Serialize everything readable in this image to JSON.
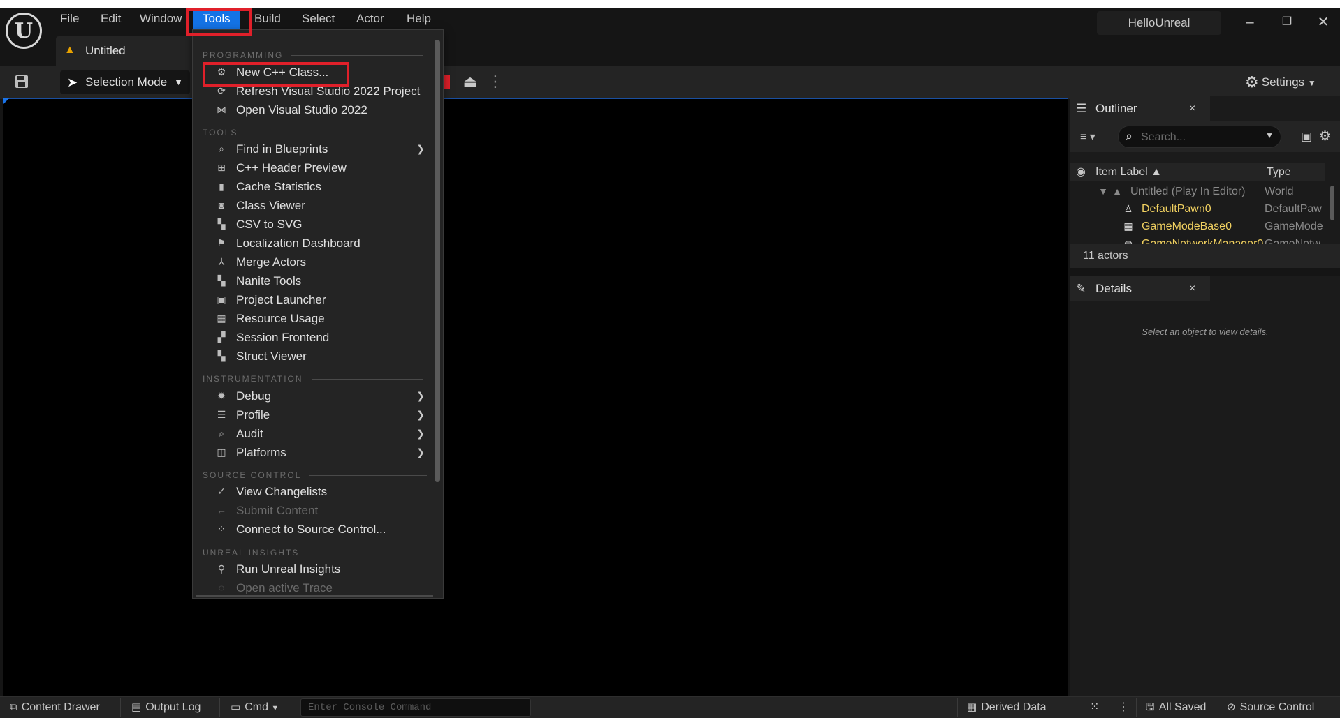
{
  "menubar": {
    "logo": "U",
    "items": [
      "File",
      "Edit",
      "Window",
      "Tools",
      "Build",
      "Select",
      "Actor",
      "Help"
    ],
    "active": "Tools",
    "project_name": "HelloUnreal",
    "minimize": "–",
    "restore": "❐",
    "close": "✕"
  },
  "tab": {
    "label": "Untitled",
    "icon": "level-icon"
  },
  "toolbar": {
    "selection_mode": "Selection Mode",
    "settings": "Settings"
  },
  "tools_menu": {
    "sections": [
      {
        "header": "PROGRAMMING",
        "items": [
          {
            "label": "New C++ Class...",
            "icon": "cpp-class-icon"
          },
          {
            "label": "Refresh Visual Studio 2022 Project",
            "icon": "refresh-icon"
          },
          {
            "label": "Open Visual Studio 2022",
            "icon": "visual-studio-icon"
          }
        ]
      },
      {
        "header": "TOOLS",
        "items": [
          {
            "label": "Find in Blueprints",
            "icon": "find-icon",
            "submenu": true
          },
          {
            "label": "C++ Header Preview",
            "icon": "header-icon"
          },
          {
            "label": "Cache Statistics",
            "icon": "chart-icon"
          },
          {
            "label": "Class Viewer",
            "icon": "class-viewer-icon"
          },
          {
            "label": "CSV to SVG",
            "icon": "csv-icon"
          },
          {
            "label": "Localization Dashboard",
            "icon": "flag-icon"
          },
          {
            "label": "Merge Actors",
            "icon": "merge-icon"
          },
          {
            "label": "Nanite Tools",
            "icon": "nanite-icon"
          },
          {
            "label": "Project Launcher",
            "icon": "launcher-icon"
          },
          {
            "label": "Resource Usage",
            "icon": "table-icon"
          },
          {
            "label": "Session Frontend",
            "icon": "session-icon"
          },
          {
            "label": "Struct Viewer",
            "icon": "struct-icon"
          }
        ]
      },
      {
        "header": "INSTRUMENTATION",
        "items": [
          {
            "label": "Debug",
            "icon": "bug-icon",
            "submenu": true
          },
          {
            "label": "Profile",
            "icon": "profile-icon",
            "submenu": true
          },
          {
            "label": "Audit",
            "icon": "audit-icon",
            "submenu": true
          },
          {
            "label": "Platforms",
            "icon": "platforms-icon",
            "submenu": true
          }
        ]
      },
      {
        "header": "SOURCE CONTROL",
        "items": [
          {
            "label": "View Changelists",
            "icon": "changelist-icon"
          },
          {
            "label": "Submit Content",
            "icon": "submit-icon",
            "disabled": true
          },
          {
            "label": "Connect to Source Control...",
            "icon": "connect-icon"
          }
        ]
      },
      {
        "header": "UNREAL INSIGHTS",
        "items": [
          {
            "label": "Run Unreal Insights",
            "icon": "insights-icon"
          },
          {
            "label": "Open active Trace",
            "icon": "trace-icon",
            "disabled": true
          }
        ]
      }
    ]
  },
  "outliner": {
    "title": "Outliner",
    "close": "×",
    "search_placeholder": "Search...",
    "col_label": "Item Label ▲",
    "col_type": "Type",
    "rows": [
      {
        "label": "Untitled (Play In Editor)",
        "type": "World",
        "color": "#8a8a8a"
      },
      {
        "label": "DefaultPawn0",
        "type": "DefaultPaw",
        "color": "#f0d060"
      },
      {
        "label": "GameModeBase0",
        "type": "GameMode",
        "color": "#f0d060"
      },
      {
        "label": "GameNetworkManager0",
        "type": "GameNetw",
        "color": "#f0d060"
      }
    ],
    "actor_count": "11 actors"
  },
  "details": {
    "title": "Details",
    "close": "×",
    "empty_message": "Select an object to view details."
  },
  "bottombar": {
    "content_drawer": "Content Drawer",
    "output_log": "Output Log",
    "cmd": "Cmd",
    "console_placeholder": "Enter Console Command",
    "derived_data": "Derived Data",
    "all_saved": "All Saved",
    "source_control": "Source Control"
  },
  "colors": {
    "accent": "#1473e6",
    "highlight": "#e0202a",
    "actor_label": "#f0d060"
  }
}
